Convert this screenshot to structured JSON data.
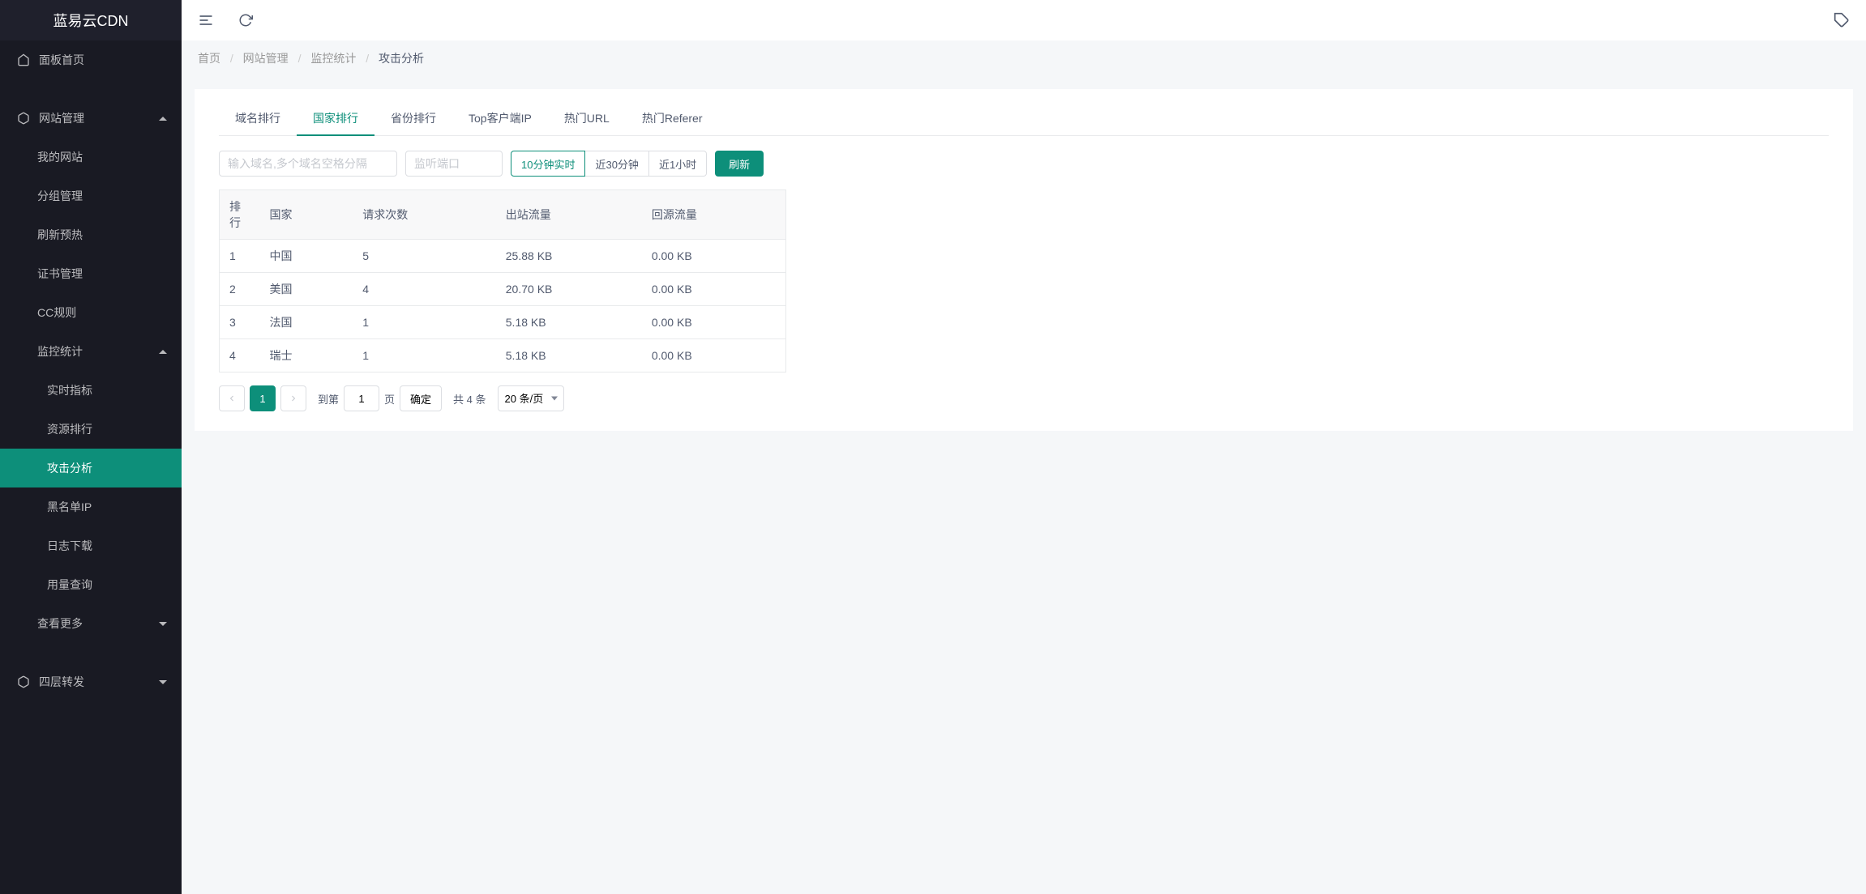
{
  "app": {
    "title": "蓝易云CDN"
  },
  "sidebar": {
    "dashboard": "面板首页",
    "site_manage": "网站管理",
    "site_items": {
      "mysite": "我的网站",
      "group": "分组管理",
      "refresh": "刷新预热",
      "cert": "证书管理",
      "cc": "CC规则"
    },
    "monitor": "监控统计",
    "monitor_items": {
      "realtime": "实时指标",
      "resource": "资源排行",
      "attack": "攻击分析",
      "blacklist": "黑名单IP",
      "log": "日志下载",
      "usage": "用量查询"
    },
    "see_more": "查看更多",
    "layer4": "四层转发"
  },
  "breadcrumb": {
    "home": "首页",
    "site": "网站管理",
    "monitor": "监控统计",
    "attack": "攻击分析"
  },
  "tabs": {
    "domain": "域名排行",
    "country": "国家排行",
    "province": "省份排行",
    "topip": "Top客户端IP",
    "hoturl": "热门URL",
    "hotref": "热门Referer"
  },
  "filters": {
    "domain_placeholder": "输入域名,多个域名空格分隔",
    "port_placeholder": "监听端口",
    "time": {
      "t10": "10分钟实时",
      "t30": "近30分钟",
      "t1h": "近1小时"
    },
    "refresh": "刷新"
  },
  "table": {
    "headers": {
      "rank": "排行",
      "country": "国家",
      "requests": "请求次数",
      "out": "出站流量",
      "origin": "回源流量"
    },
    "rows": [
      {
        "rank": "1",
        "country": "中国",
        "requests": "5",
        "out": "25.88 KB",
        "origin": "0.00 KB"
      },
      {
        "rank": "2",
        "country": "美国",
        "requests": "4",
        "out": "20.70 KB",
        "origin": "0.00 KB"
      },
      {
        "rank": "3",
        "country": "法国",
        "requests": "1",
        "out": "5.18 KB",
        "origin": "0.00 KB"
      },
      {
        "rank": "4",
        "country": "瑞士",
        "requests": "1",
        "out": "5.18 KB",
        "origin": "0.00 KB"
      }
    ]
  },
  "pagination": {
    "current": "1",
    "goto_prefix": "到第",
    "goto_value": "1",
    "goto_suffix": "页",
    "confirm": "确定",
    "total": "共 4 条",
    "pagesize": "20 条/页"
  }
}
